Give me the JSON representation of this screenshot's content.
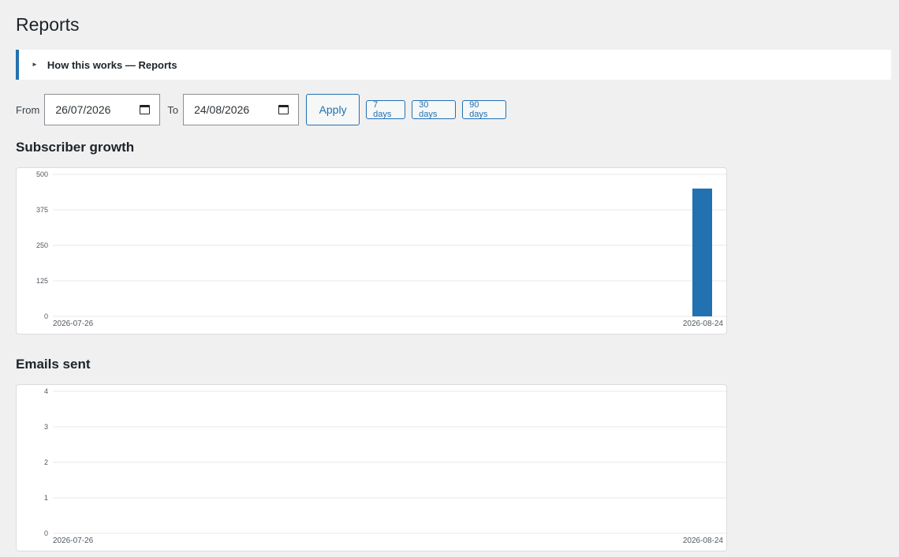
{
  "page": {
    "title": "Reports"
  },
  "help": {
    "label": "How this works — Reports",
    "icon": "triangle-right-icon"
  },
  "filters": {
    "from_label": "From",
    "from_value": "26/07/2026",
    "to_label": "To",
    "to_value": "24/08/2026",
    "apply_label": "Apply",
    "ranges": [
      "7 days",
      "30 days",
      "90 days"
    ]
  },
  "colors": {
    "accent": "#2271b1",
    "bar": "#2271b1",
    "grid": "#e8e8e8",
    "background": "#f0f0f1"
  },
  "sections": {
    "subscriber_growth": "Subscriber growth",
    "emails_sent": "Emails sent"
  },
  "chart_data": [
    {
      "type": "bar",
      "title": "Subscriber growth",
      "x_start": "2026-07-26",
      "x_end": "2026-08-24",
      "x_ticks": [
        "2026-07-26",
        "2026-08-24"
      ],
      "y_ticks": [
        0,
        125,
        250,
        375,
        500
      ],
      "ylim": [
        0,
        500
      ],
      "grid": true,
      "points": [
        {
          "date": "2026-08-24",
          "value": 450
        }
      ]
    },
    {
      "type": "bar",
      "title": "Emails sent",
      "x_start": "2026-07-26",
      "x_end": "2026-08-24",
      "x_ticks": [
        "2026-07-26",
        "2026-08-24"
      ],
      "y_ticks": [
        0,
        1,
        2,
        3,
        4
      ],
      "ylim": [
        0,
        4
      ],
      "grid": true,
      "points": []
    }
  ]
}
